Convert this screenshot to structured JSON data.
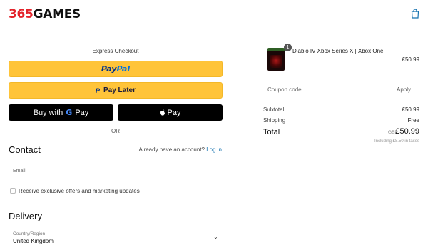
{
  "header": {
    "logo_num": "365",
    "logo_word": "GAMES"
  },
  "express": {
    "title": "Express Checkout",
    "paypal_pay": "Pay",
    "paypal_pal": "Pal",
    "pay_later_mark": "P",
    "pay_later": "Pay Later",
    "gpay_prefix": "Buy with",
    "gpay_g": "G",
    "gpay_pay": "Pay",
    "apple_pay": "Pay",
    "or": "OR"
  },
  "contact": {
    "title": "Contact",
    "account_question": "Already have an account?",
    "login_link": "Log in",
    "email_label": "Email",
    "offers_label": "Receive exclusive offers and marketing updates"
  },
  "delivery": {
    "title": "Delivery",
    "country_label": "Country/Region",
    "country_value": "United Kingdom"
  },
  "cart": {
    "quantity": "1",
    "product_name": "Diablo IV Xbox Series X | Xbox One",
    "product_price": "£50.99"
  },
  "coupon": {
    "label": "Coupon code",
    "apply": "Apply"
  },
  "summary": {
    "subtotal_label": "Subtotal",
    "subtotal_value": "£50.99",
    "shipping_label": "Shipping",
    "shipping_value": "Free",
    "total_label": "Total",
    "total_currency": "GBP",
    "total_value": "£50.99",
    "tax_note": "Including £8.50 in taxes"
  },
  "icons": {
    "bag": "shopping-bag-icon",
    "chevron": "chevron-down-icon",
    "apple": "apple-icon"
  },
  "colors": {
    "brand_red": "#e3232b",
    "paypal_yellow": "#ffc439",
    "link_blue": "#1773b0"
  }
}
